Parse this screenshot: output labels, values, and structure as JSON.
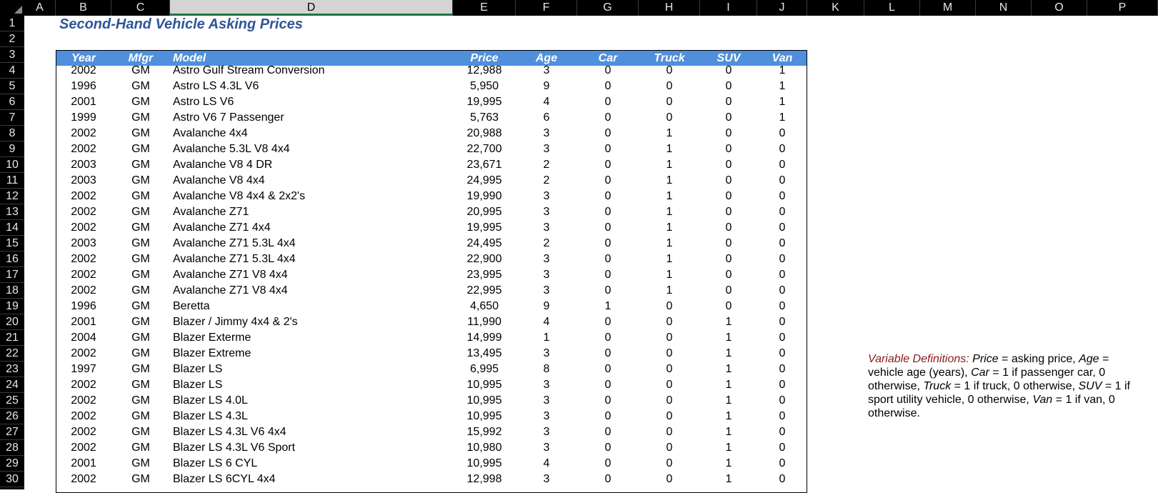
{
  "columns": [
    "A",
    "B",
    "C",
    "D",
    "E",
    "F",
    "G",
    "H",
    "I",
    "J",
    "K",
    "L",
    "M",
    "N",
    "O",
    "P"
  ],
  "selected_column": "D",
  "rows": [
    "1",
    "2",
    "3",
    "4",
    "5",
    "6",
    "7",
    "8",
    "9",
    "10",
    "11",
    "12",
    "13",
    "14",
    "15",
    "16",
    "17",
    "18",
    "19",
    "20",
    "21",
    "22",
    "23",
    "24",
    "25",
    "26",
    "27",
    "28",
    "29",
    "30"
  ],
  "sheet": {
    "title": "Second-Hand Vehicle Asking Prices",
    "headers": {
      "year": "Year",
      "mfgr": "Mfgr",
      "model": "Model",
      "price": "Price",
      "age": "Age",
      "car": "Car",
      "truck": "Truck",
      "suv": "SUV",
      "van": "Van"
    },
    "records": [
      {
        "year": "2002",
        "mfgr": "GM",
        "model": "Astro Gulf Stream Conversion",
        "price": "12,988",
        "age": "3",
        "car": "0",
        "truck": "0",
        "suv": "0",
        "van": "1"
      },
      {
        "year": "1996",
        "mfgr": "GM",
        "model": "Astro LS 4.3L V6",
        "price": "5,950",
        "age": "9",
        "car": "0",
        "truck": "0",
        "suv": "0",
        "van": "1"
      },
      {
        "year": "2001",
        "mfgr": "GM",
        "model": "Astro LS V6",
        "price": "19,995",
        "age": "4",
        "car": "0",
        "truck": "0",
        "suv": "0",
        "van": "1"
      },
      {
        "year": "1999",
        "mfgr": "GM",
        "model": "Astro V6 7 Passenger",
        "price": "5,763",
        "age": "6",
        "car": "0",
        "truck": "0",
        "suv": "0",
        "van": "1"
      },
      {
        "year": "2002",
        "mfgr": "GM",
        "model": "Avalanche 4x4",
        "price": "20,988",
        "age": "3",
        "car": "0",
        "truck": "1",
        "suv": "0",
        "van": "0"
      },
      {
        "year": "2002",
        "mfgr": "GM",
        "model": "Avalanche 5.3L V8 4x4",
        "price": "22,700",
        "age": "3",
        "car": "0",
        "truck": "1",
        "suv": "0",
        "van": "0"
      },
      {
        "year": "2003",
        "mfgr": "GM",
        "model": "Avalanche V8 4 DR",
        "price": "23,671",
        "age": "2",
        "car": "0",
        "truck": "1",
        "suv": "0",
        "van": "0"
      },
      {
        "year": "2003",
        "mfgr": "GM",
        "model": "Avalanche V8 4x4",
        "price": "24,995",
        "age": "2",
        "car": "0",
        "truck": "1",
        "suv": "0",
        "van": "0"
      },
      {
        "year": "2002",
        "mfgr": "GM",
        "model": "Avalanche V8 4x4 & 2x2's",
        "price": "19,990",
        "age": "3",
        "car": "0",
        "truck": "1",
        "suv": "0",
        "van": "0"
      },
      {
        "year": "2002",
        "mfgr": "GM",
        "model": "Avalanche Z71",
        "price": "20,995",
        "age": "3",
        "car": "0",
        "truck": "1",
        "suv": "0",
        "van": "0"
      },
      {
        "year": "2002",
        "mfgr": "GM",
        "model": "Avalanche Z71 4x4",
        "price": "19,995",
        "age": "3",
        "car": "0",
        "truck": "1",
        "suv": "0",
        "van": "0"
      },
      {
        "year": "2003",
        "mfgr": "GM",
        "model": "Avalanche Z71 5.3L  4x4",
        "price": "24,495",
        "age": "2",
        "car": "0",
        "truck": "1",
        "suv": "0",
        "van": "0"
      },
      {
        "year": "2002",
        "mfgr": "GM",
        "model": "Avalanche Z71 5.3L  4x4",
        "price": "22,900",
        "age": "3",
        "car": "0",
        "truck": "1",
        "suv": "0",
        "van": "0"
      },
      {
        "year": "2002",
        "mfgr": "GM",
        "model": "Avalanche Z71 V8 4x4",
        "price": "23,995",
        "age": "3",
        "car": "0",
        "truck": "1",
        "suv": "0",
        "van": "0"
      },
      {
        "year": "2002",
        "mfgr": "GM",
        "model": "Avalanche Z71 V8 4x4",
        "price": "22,995",
        "age": "3",
        "car": "0",
        "truck": "1",
        "suv": "0",
        "van": "0"
      },
      {
        "year": "1996",
        "mfgr": "GM",
        "model": "Beretta",
        "price": "4,650",
        "age": "9",
        "car": "1",
        "truck": "0",
        "suv": "0",
        "van": "0"
      },
      {
        "year": "2001",
        "mfgr": "GM",
        "model": "Blazer / Jimmy 4x4 & 2's",
        "price": "11,990",
        "age": "4",
        "car": "0",
        "truck": "0",
        "suv": "1",
        "van": "0"
      },
      {
        "year": "2004",
        "mfgr": "GM",
        "model": "Blazer Exterme",
        "price": "14,999",
        "age": "1",
        "car": "0",
        "truck": "0",
        "suv": "1",
        "van": "0"
      },
      {
        "year": "2002",
        "mfgr": "GM",
        "model": "Blazer Extreme",
        "price": "13,495",
        "age": "3",
        "car": "0",
        "truck": "0",
        "suv": "1",
        "van": "0"
      },
      {
        "year": "1997",
        "mfgr": "GM",
        "model": "Blazer LS",
        "price": "6,995",
        "age": "8",
        "car": "0",
        "truck": "0",
        "suv": "1",
        "van": "0"
      },
      {
        "year": "2002",
        "mfgr": "GM",
        "model": "Blazer LS",
        "price": "10,995",
        "age": "3",
        "car": "0",
        "truck": "0",
        "suv": "1",
        "van": "0"
      },
      {
        "year": "2002",
        "mfgr": "GM",
        "model": "Blazer LS 4.0L",
        "price": "10,995",
        "age": "3",
        "car": "0",
        "truck": "0",
        "suv": "1",
        "van": "0"
      },
      {
        "year": "2002",
        "mfgr": "GM",
        "model": "Blazer LS 4.3L",
        "price": "10,995",
        "age": "3",
        "car": "0",
        "truck": "0",
        "suv": "1",
        "van": "0"
      },
      {
        "year": "2002",
        "mfgr": "GM",
        "model": "Blazer LS 4.3L V6 4x4",
        "price": "15,992",
        "age": "3",
        "car": "0",
        "truck": "0",
        "suv": "1",
        "van": "0"
      },
      {
        "year": "2002",
        "mfgr": "GM",
        "model": "Blazer LS 4.3L V6 Sport",
        "price": "10,980",
        "age": "3",
        "car": "0",
        "truck": "0",
        "suv": "1",
        "van": "0"
      },
      {
        "year": "2001",
        "mfgr": "GM",
        "model": "Blazer LS 6 CYL",
        "price": "10,995",
        "age": "4",
        "car": "0",
        "truck": "0",
        "suv": "1",
        "van": "0"
      },
      {
        "year": "2002",
        "mfgr": "GM",
        "model": "Blazer LS 6CYL 4x4",
        "price": "12,998",
        "age": "3",
        "car": "0",
        "truck": "0",
        "suv": "1",
        "van": "0"
      }
    ],
    "note": {
      "label": "Variable Definitions:",
      "price_term": "Price",
      "price_def": " = asking price, ",
      "age_term": "Age",
      "age_def": " = vehicle age (years), ",
      "car_term": "Car",
      "car_def": " = 1 if passenger car, 0 otherwise, ",
      "truck_term": "Truck",
      "truck_def": " = 1 if truck, 0 otherwise, ",
      "suv_term": "SUV",
      "suv_def": " = 1 if sport utility vehicle, 0 otherwise, ",
      "van_term": "Van",
      "van_def": " = 1 if van, 0 otherwise."
    }
  },
  "colors": {
    "header_fill": "#4f8fdb",
    "title": "#2f5597",
    "note_label": "#8b1a1a",
    "grid_header_bg": "#000000",
    "selected_col_bg": "#d4d4d4"
  }
}
